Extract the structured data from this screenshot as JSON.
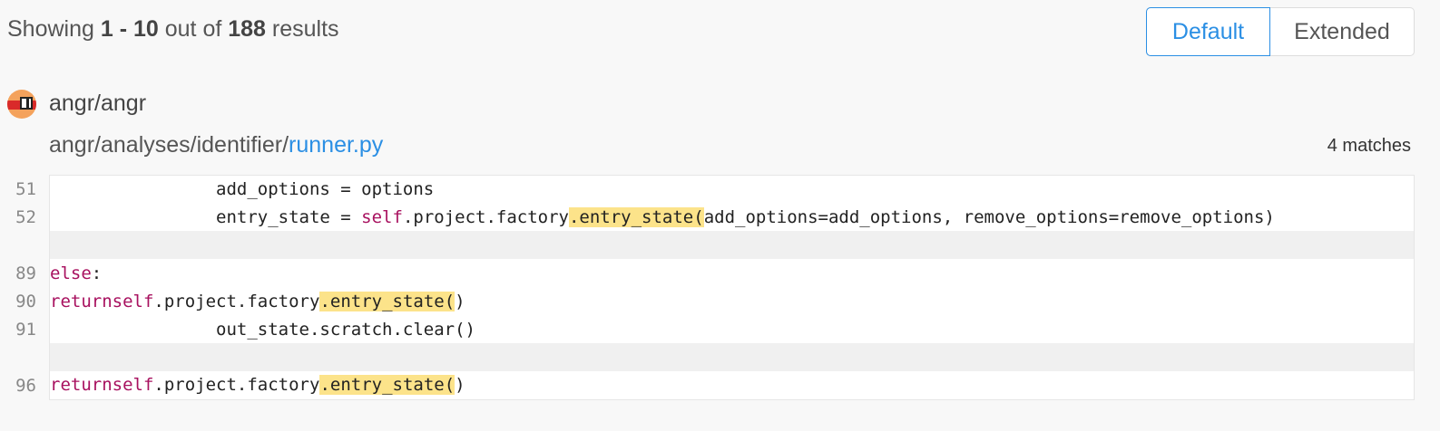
{
  "summary": {
    "prefix": "Showing ",
    "range": "1 - 10",
    "middle": " out of ",
    "total": "188",
    "suffix": " results"
  },
  "view_toggle": {
    "default_label": "Default",
    "extended_label": "Extended",
    "selected": "Default"
  },
  "result": {
    "repo": "angr/angr",
    "path_dir": "angr/analyses/identifier/",
    "path_file": "runner.py",
    "matches": "4 matches",
    "avatar_icon": "repo-avatar-icon"
  },
  "code": {
    "lines": [
      {
        "num": "51",
        "text": "                add_options = options"
      },
      {
        "num": "52",
        "text": "                entry_state = self.project.factory.entry_state(add_options=add_options, remove_options=remove_options)"
      },
      {
        "num": "89",
        "text": "                else:"
      },
      {
        "num": "90",
        "text": "                    return self.project.factory.entry_state()"
      },
      {
        "num": "91",
        "text": "                out_state.scratch.clear()"
      },
      {
        "num": "96",
        "text": "                return self.project.factory.entry_state()"
      }
    ],
    "highlight_term": ".entry_state("
  },
  "colors": {
    "accent": "#2b8fe4",
    "keyword": "#a8115f",
    "highlight": "#fce38a"
  }
}
